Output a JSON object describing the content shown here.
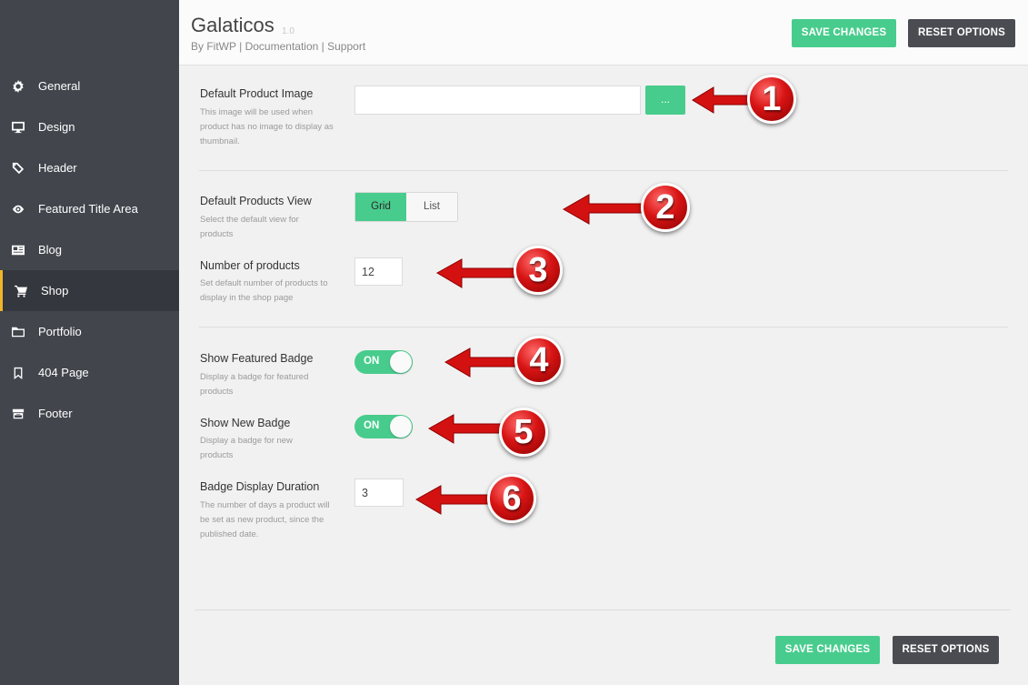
{
  "app": {
    "title": "Galaticos",
    "version": "1.0",
    "by": "By FitWP",
    "sep": "|",
    "documentation": "Documentation",
    "support": "Support"
  },
  "buttons": {
    "save": "SAVE CHANGES",
    "reset": "RESET OPTIONS"
  },
  "sidebar": {
    "items": [
      {
        "label": "General",
        "icon": "gear-icon"
      },
      {
        "label": "Design",
        "icon": "monitor-icon"
      },
      {
        "label": "Header",
        "icon": "tag-icon"
      },
      {
        "label": "Featured Title Area",
        "icon": "eye-icon"
      },
      {
        "label": "Blog",
        "icon": "newspaper-icon"
      },
      {
        "label": "Shop",
        "icon": "cart-icon",
        "active": true
      },
      {
        "label": "Portfolio",
        "icon": "folder-icon"
      },
      {
        "label": "404 Page",
        "icon": "bookmark-icon"
      },
      {
        "label": "Footer",
        "icon": "archive-icon"
      }
    ]
  },
  "settings": {
    "default_product_image": {
      "label": "Default Product Image",
      "desc": "This image will be used when product has no image to display as thumbnail.",
      "value": "",
      "browse": "..."
    },
    "default_products_view": {
      "label": "Default Products View",
      "desc": "Select the default view for products",
      "options": [
        "Grid",
        "List"
      ],
      "selected": "Grid"
    },
    "number_of_products": {
      "label": "Number of products",
      "desc": "Set default number of products to display in the shop page",
      "value": "12"
    },
    "show_featured_badge": {
      "label": "Show Featured Badge",
      "desc": "Display a badge for featured products",
      "state": "ON"
    },
    "show_new_badge": {
      "label": "Show New Badge",
      "desc": "Display a badge for new products",
      "state": "ON"
    },
    "badge_display_duration": {
      "label": "Badge Display Duration",
      "desc": "The number of days a product will be set as new product, since the published date.",
      "value": "3"
    }
  },
  "annotations": [
    "1",
    "2",
    "3",
    "4",
    "5",
    "6"
  ],
  "colors": {
    "accent": "#48cc8d",
    "sidebar": "#42454c",
    "sidebar_active": "#34373d",
    "active_marker": "#f0b429",
    "dark_button": "#4a4c52",
    "annotation_red": "#d81414"
  }
}
